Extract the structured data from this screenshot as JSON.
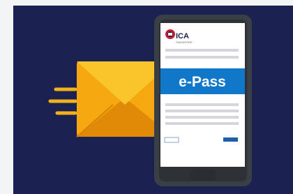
{
  "illustration": {
    "brand_name": "ICA",
    "brand_subtext": "SINGAPORE",
    "banner_text": "e-Pass",
    "colors": {
      "background": "#1b2150",
      "envelope": "#f2a20f",
      "envelope_flap": "#f9c22a",
      "banner": "#1178c9",
      "phone_body": "#3a3f45"
    }
  }
}
